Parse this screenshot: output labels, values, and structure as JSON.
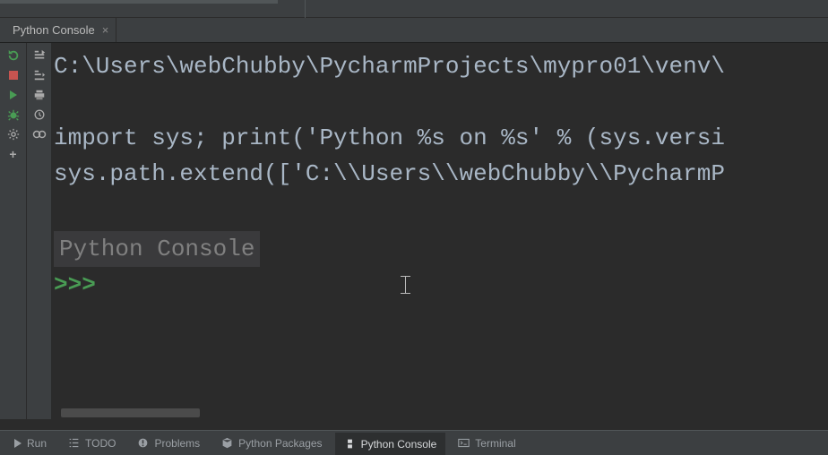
{
  "tab": {
    "title": "Python Console",
    "close_glyph": "×"
  },
  "left_toolbar": {
    "rerun": "↻",
    "stop": "■",
    "run": "▶",
    "debug": "🐞",
    "settings": "⚙",
    "add": "+"
  },
  "right_toolbar": {
    "soft_wrap": "≡",
    "scroll_to_end": "⤓",
    "print": "🖶",
    "history": "⟳",
    "link": "∞"
  },
  "console": {
    "line1": "C:\\Users\\webChubby\\PycharmProjects\\mypro01\\venv\\",
    "line2": "import sys; print('Python %s on %s' % (sys.versi",
    "line3": "sys.path.extend(['C:\\\\Users\\\\webChubby\\\\PycharmP",
    "label": "Python Console",
    "prompt": ">>> "
  },
  "status": {
    "run": "Run",
    "todo": "TODO",
    "problems": "Problems",
    "packages": "Python Packages",
    "console": "Python Console",
    "terminal": "Terminal"
  }
}
